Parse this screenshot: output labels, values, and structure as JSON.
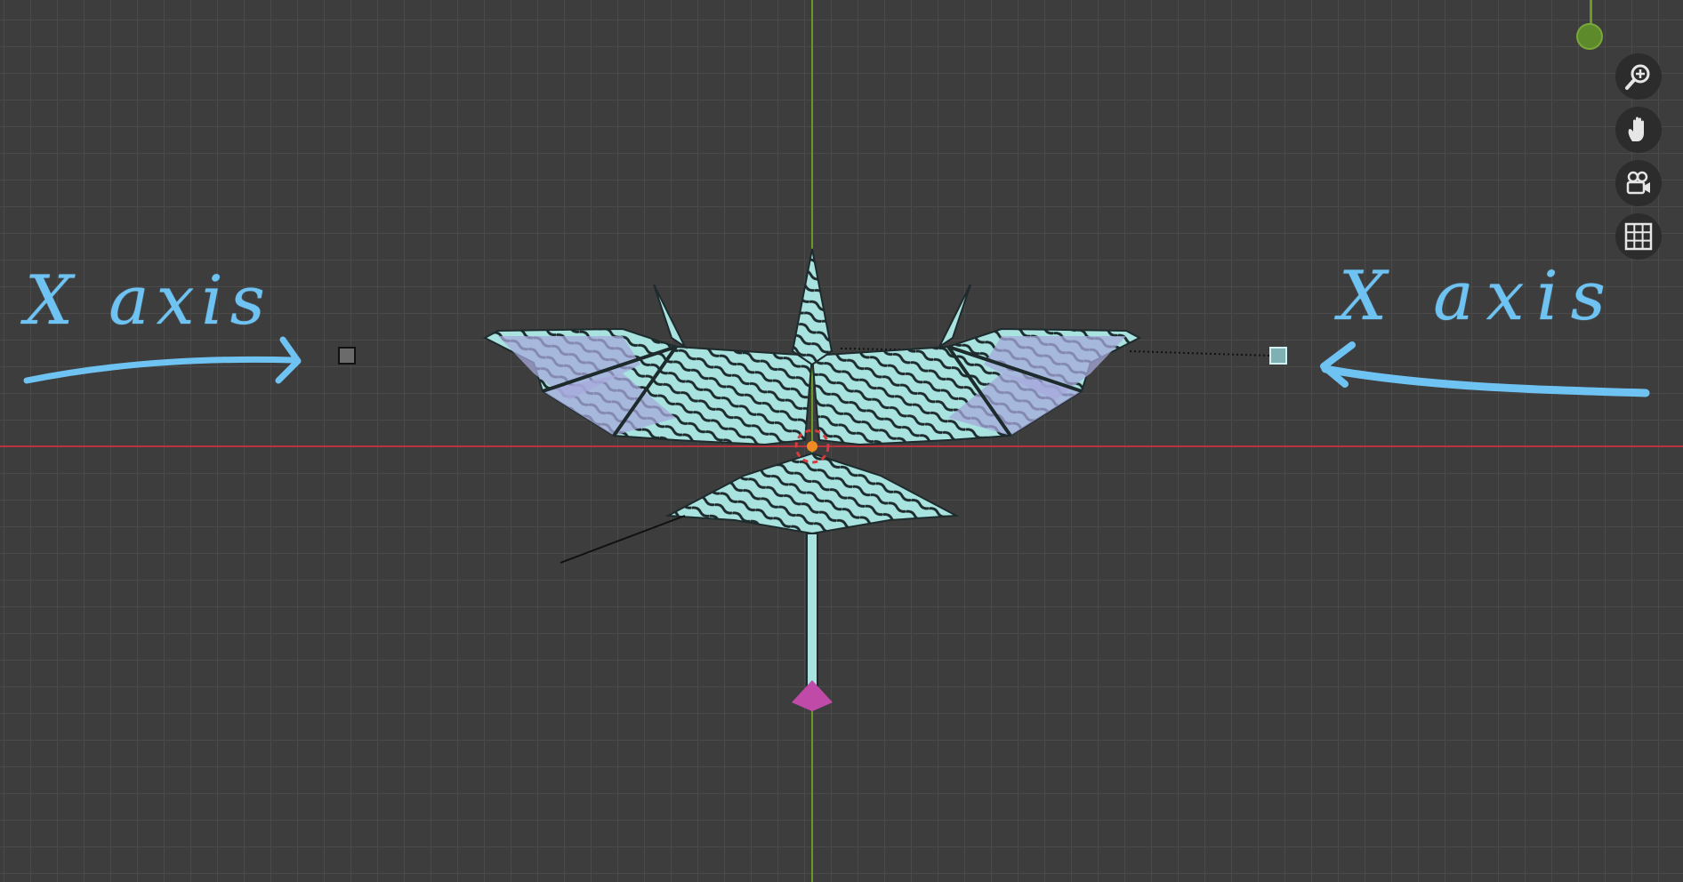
{
  "annotations": {
    "left_label": "X axis",
    "right_label": "X axis"
  },
  "viewport": {
    "grid": true,
    "x_axis_color": "#b7343f",
    "y_axis_color": "#6a9a23",
    "creature_color": "#a9e3e0",
    "stripe_color": "#1e2b2d",
    "membrane_color": "#a7a9dc",
    "tail_tip_color": "#c04aa8",
    "annotation_color": "#6fc3f2"
  },
  "toolbar": {
    "zoom_icon": "zoom-in-icon",
    "pan_icon": "hand-icon",
    "camera_icon": "camera-icon",
    "ortho_icon": "grid-icon"
  }
}
